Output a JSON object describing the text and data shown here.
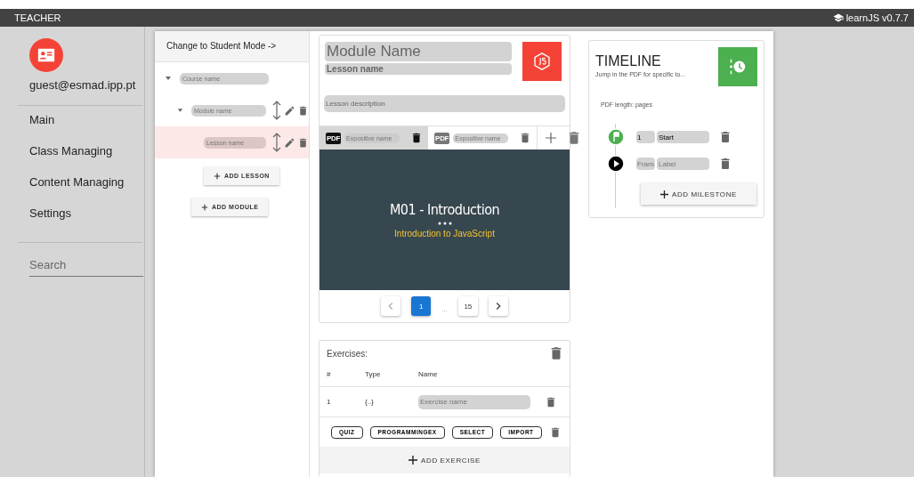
{
  "top_bar": {
    "title": "TEACHER",
    "brand": "learnJS v0.7.7"
  },
  "sidebar": {
    "email": "guest@esmad.ipp.pt",
    "items": [
      {
        "label": "Main"
      },
      {
        "label": "Class Managing"
      },
      {
        "label": "Content Managing"
      },
      {
        "label": "Settings"
      }
    ],
    "search": {
      "placeholder": "Search"
    }
  },
  "tree": {
    "mode_link": "Change to Student Mode ->",
    "course": {
      "placeholder": "Course name"
    },
    "module": {
      "placeholder": "Module name"
    },
    "lesson": {
      "placeholder": "Lesson name",
      "selected": true
    },
    "add_lesson": "ADD LESSON",
    "add_module": "ADD MODULE"
  },
  "lesson_editor": {
    "module_name": {
      "placeholder": "Module Name"
    },
    "lesson_name": {
      "placeholder": "Lesson name"
    },
    "description": {
      "placeholder": "Lesson description"
    },
    "files": [
      {
        "badge": "PDF",
        "placeholder": "Expositive name",
        "selected": true
      },
      {
        "badge": "PDF",
        "placeholder": "Expositive name",
        "selected": false
      }
    ],
    "slide": {
      "title": "M01 - Introduction",
      "subtitle": "Introduction to JavaScript"
    },
    "pagination": [
      {
        "label": "1",
        "kind": "page",
        "selected": true
      },
      {
        "label": "...",
        "kind": "gap"
      },
      {
        "label": "15",
        "kind": "page",
        "selected": false
      }
    ]
  },
  "exercises": {
    "title": "Exercises:",
    "columns": [
      "#",
      "Type",
      "Name"
    ],
    "rows": [
      {
        "number": "1",
        "type": "{..}",
        "placeholder": "Exercise name"
      }
    ],
    "type_buttons": [
      "QUIZ",
      "PROGRAMMINGEX",
      "SELECT",
      "IMPORT"
    ],
    "add_button": "ADD EXERCISE"
  },
  "timeline": {
    "title": "TIMELINE",
    "subtitle": "Jump in the PDF for specific to...",
    "pdf_length": "PDF length: pages",
    "milestones": [
      {
        "kind": "start",
        "frame": {
          "value": "1"
        },
        "label": {
          "value": "Start"
        }
      },
      {
        "kind": "play",
        "frame": {
          "placeholder": "Fram"
        },
        "label": {
          "placeholder": "Label"
        }
      }
    ],
    "add_button": "ADD MILESTONE"
  }
}
